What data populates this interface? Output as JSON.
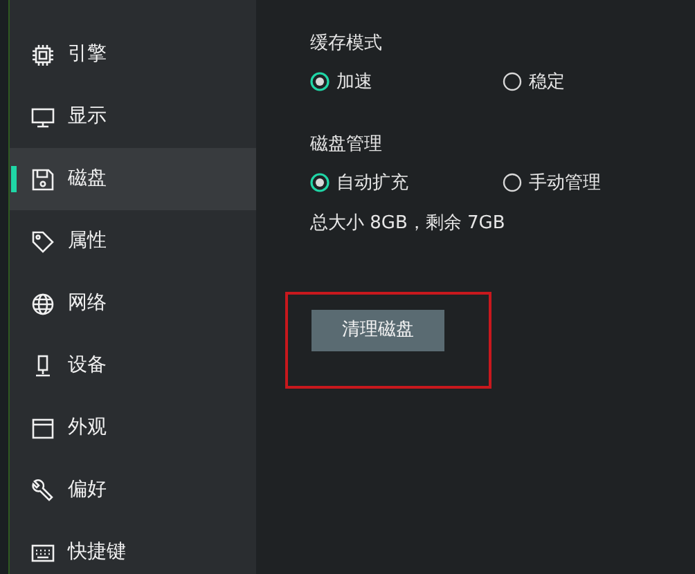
{
  "sidebar": {
    "items": [
      {
        "label": "引擎",
        "selected": false
      },
      {
        "label": "显示",
        "selected": false
      },
      {
        "label": "磁盘",
        "selected": true
      },
      {
        "label": "属性",
        "selected": false
      },
      {
        "label": "网络",
        "selected": false
      },
      {
        "label": "设备",
        "selected": false
      },
      {
        "label": "外观",
        "selected": false
      },
      {
        "label": "偏好",
        "selected": false
      },
      {
        "label": "快捷键",
        "selected": false
      }
    ]
  },
  "sections": [
    {
      "title": "缓存模式",
      "options": [
        {
          "label": "加速",
          "selected": true
        },
        {
          "label": "稳定",
          "selected": false
        }
      ]
    },
    {
      "title": "磁盘管理",
      "options": [
        {
          "label": "自动扩充",
          "selected": true
        },
        {
          "label": "手动管理",
          "selected": false
        }
      ],
      "note": "总大小 8GB，剩余 7GB"
    }
  ],
  "button": {
    "label": "清理磁盘",
    "highlighted": true
  }
}
